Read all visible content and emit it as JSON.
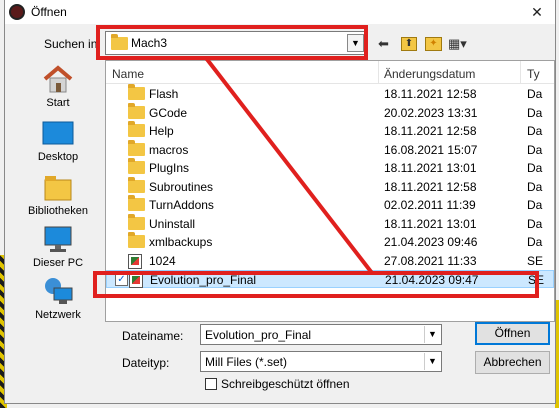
{
  "window": {
    "title": "Öffnen",
    "close_glyph": "✕"
  },
  "lookin": {
    "label": "Suchen in:",
    "value": "Mach3"
  },
  "toolbar": {
    "back_glyph": "⬅",
    "up_glyph": "⬆",
    "new_folder_glyph": "✦",
    "view_glyph": "▦▾"
  },
  "places": [
    {
      "label": "Start",
      "icon": "home-icon"
    },
    {
      "label": "Desktop",
      "icon": "desktop-icon"
    },
    {
      "label": "Bibliotheken",
      "icon": "libraries-icon"
    },
    {
      "label": "Dieser PC",
      "icon": "computer-icon"
    },
    {
      "label": "Netzwerk",
      "icon": "network-icon"
    }
  ],
  "columns": {
    "name": "Name",
    "date": "Änderungsdatum",
    "type": "Ty"
  },
  "files": [
    {
      "name": "Flash",
      "date": "18.11.2021 12:58",
      "type": "Da",
      "kind": "folder"
    },
    {
      "name": "GCode",
      "date": "20.02.2023 13:31",
      "type": "Da",
      "kind": "folder"
    },
    {
      "name": "Help",
      "date": "18.11.2021 12:58",
      "type": "Da",
      "kind": "folder"
    },
    {
      "name": "macros",
      "date": "16.08.2021 15:07",
      "type": "Da",
      "kind": "folder"
    },
    {
      "name": "PlugIns",
      "date": "18.11.2021 13:01",
      "type": "Da",
      "kind": "folder"
    },
    {
      "name": "Subroutines",
      "date": "18.11.2021 12:58",
      "type": "Da",
      "kind": "folder"
    },
    {
      "name": "TurnAddons",
      "date": "02.02.2011 11:39",
      "type": "Da",
      "kind": "folder"
    },
    {
      "name": "Uninstall",
      "date": "18.11.2021 13:01",
      "type": "Da",
      "kind": "folder"
    },
    {
      "name": "xmlbackups",
      "date": "21.04.2023 09:46",
      "type": "Da",
      "kind": "folder"
    },
    {
      "name": "1024",
      "date": "27.08.2021 11:33",
      "type": "SE",
      "kind": "file"
    },
    {
      "name": "Evolution_pro_Final",
      "date": "21.04.2023 09:47",
      "type": "SE",
      "kind": "file",
      "selected": true
    }
  ],
  "filename": {
    "label": "Dateiname:",
    "value": "Evolution_pro_Final"
  },
  "filetype": {
    "label": "Dateityp:",
    "value": "Mill Files (*.set)"
  },
  "readonly": {
    "label": "Schreibgeschützt öffnen",
    "checked": false
  },
  "buttons": {
    "open": "Öffnen",
    "cancel": "Abbrechen"
  },
  "colors": {
    "annotation": "#e0201e",
    "selection": "#cce8ff",
    "accent": "#0078d7"
  }
}
